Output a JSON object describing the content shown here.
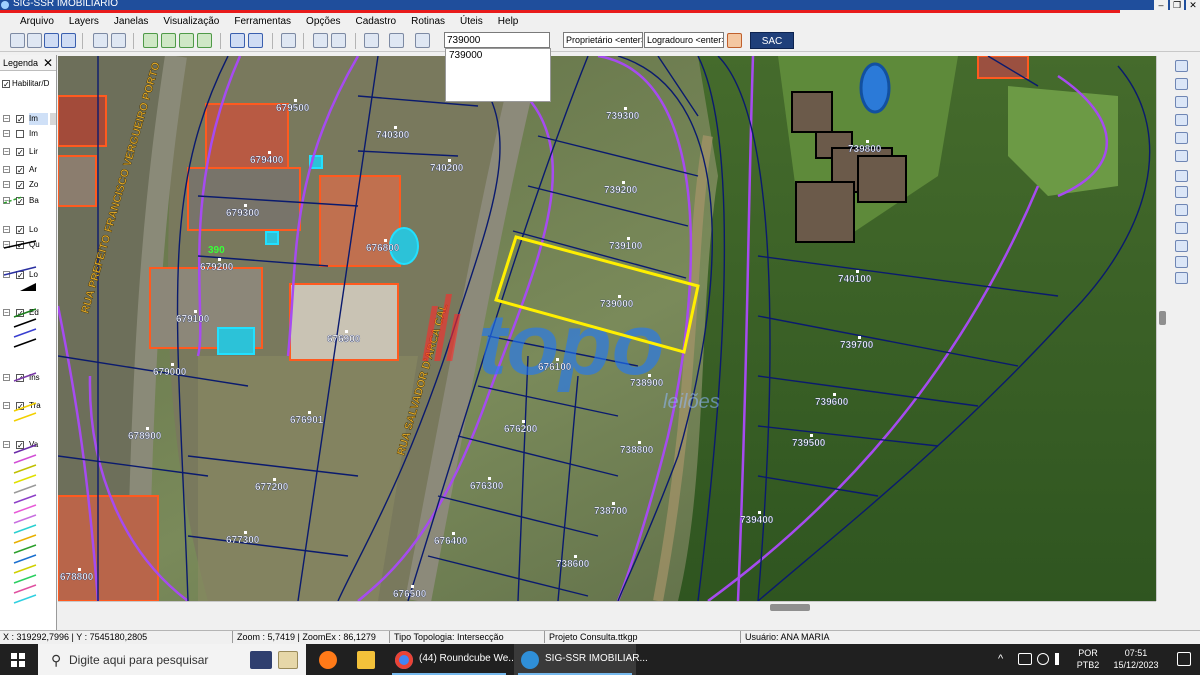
{
  "window": {
    "title": "SIG-SSR IMOBILIARIO",
    "controls": [
      "–",
      "❐",
      "✕"
    ]
  },
  "menu": [
    "Arquivo",
    "Layers",
    "Janelas",
    "Visualização",
    "Ferramentas",
    "Opções",
    "Cadastro",
    "Rotinas",
    "Úteis",
    "Help"
  ],
  "toolbar": {
    "search_value": "739000",
    "suggestion": "739000",
    "owner_placeholder": "Proprietário <enter>",
    "street_placeholder": "Logradouro <enter>",
    "sac_label": "SAC"
  },
  "legend": {
    "title": "Legenda",
    "close": "✕",
    "enable_label": "Habilitar/D",
    "items": [
      {
        "label": "Im",
        "checked": true
      },
      {
        "label": "Im",
        "checked": false
      },
      {
        "label": "Lir",
        "checked": true
      },
      {
        "label": "Ar",
        "checked": true
      },
      {
        "label": "Zo",
        "checked": true
      },
      {
        "label": "Ba",
        "checked": true
      },
      {
        "label": "Lo",
        "checked": true
      },
      {
        "label": "Qu",
        "checked": true
      },
      {
        "label": "Lo",
        "checked": true
      },
      {
        "label": "Ed",
        "checked": true
      },
      {
        "label": "Ins",
        "checked": true
      },
      {
        "label": "Tra",
        "checked": true
      },
      {
        "label": "Va",
        "checked": true
      }
    ]
  },
  "map": {
    "streets": [
      "RUA PREFEITO FRANCISCO VERGUEIRO PORTO",
      "RUA SALVADOR D'ARCA CAL"
    ],
    "selected_lot": "739000",
    "highlight_label": "390",
    "watermark": {
      "brand": "topo",
      "sub": "leilões"
    },
    "lots": [
      "679500",
      "740300",
      "739300",
      "740200",
      "679400",
      "739200",
      "739800",
      "679300",
      "739100",
      "676800",
      "679200",
      "740100",
      "739000",
      "679100",
      "676900",
      "739700",
      "679000",
      "676100",
      "738900",
      "739600",
      "676901",
      "678900",
      "676200",
      "739500",
      "738800",
      "677200",
      "676300",
      "738700",
      "739400",
      "677300",
      "676400",
      "738600",
      "678800",
      "676500"
    ]
  },
  "status": {
    "coords": "X : 319292,7996 | Y : 7545180,2805",
    "zoom": "Zoom : 5,7419 | ZoomEx : 86,1279",
    "topology": "Tipo Topologia: Intersecção",
    "project": "Projeto Consulta.ttkgp",
    "user": "Usuário: ANA MARIA"
  },
  "taskbar": {
    "search_placeholder": "Digite aqui para pesquisar",
    "apps": [
      {
        "label": "(44) Roundcube We...",
        "active": false
      },
      {
        "label": "SIG-SSR IMOBILIAR...",
        "active": true
      }
    ],
    "lang_top": "POR",
    "lang_bottom": "PTB2",
    "time": "07:51",
    "date": "15/12/2023"
  },
  "colors": {
    "parcel_line": "#0a1a6e",
    "zone_line": "#a64bf0",
    "selection": "#ffef00",
    "building": "#ff5a1f",
    "lot_label": "#ffffff",
    "watermark": "#1e78ff"
  }
}
